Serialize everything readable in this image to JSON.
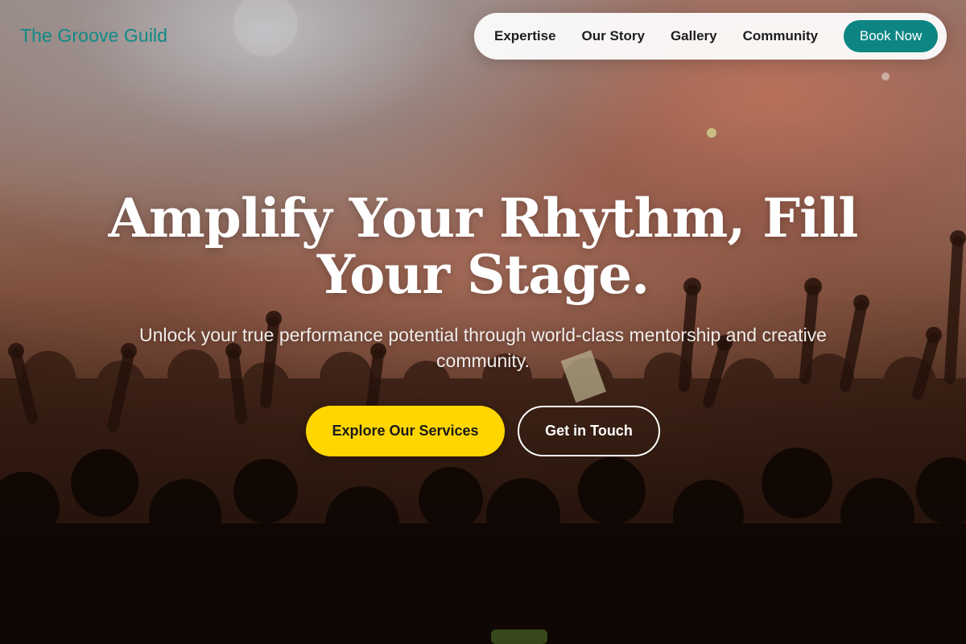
{
  "brand": {
    "name": "The Groove Guild"
  },
  "nav": {
    "links": [
      "Expertise",
      "Our Story",
      "Gallery",
      "Community"
    ],
    "cta_label": "Book Now"
  },
  "hero": {
    "title": "Amplify Your Rhythm, Fill Your Stage.",
    "subtitle": "Unlock your true performance potential through world-class mentorship and creative community.",
    "primary_cta": "Explore Our Services",
    "secondary_cta": "Get in Touch"
  },
  "colors": {
    "brand_teal": "#0f8a86",
    "button_teal": "#0d8683",
    "cta_yellow": "#ffd600",
    "text_white": "#ffffff"
  },
  "background": {
    "image_subject": "concert crowd with raised hands under stage lights"
  }
}
